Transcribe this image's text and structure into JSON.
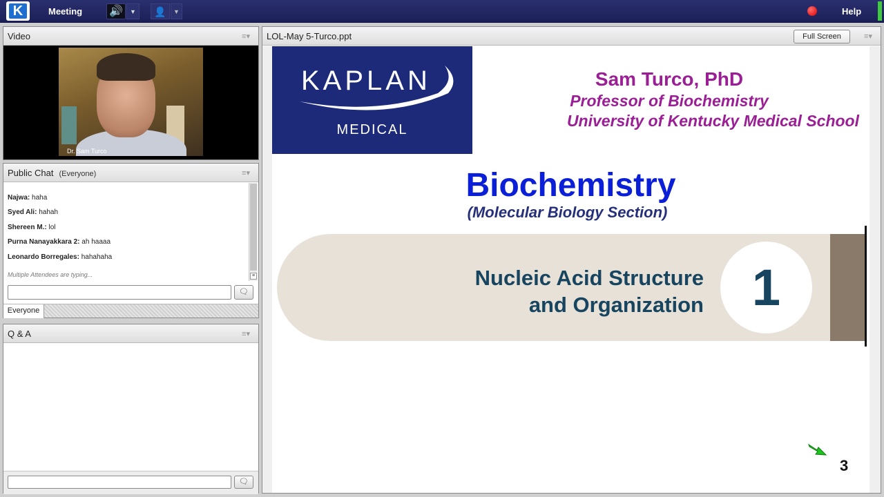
{
  "toolbar": {
    "logo_letter": "K",
    "meeting_label": "Meeting",
    "help_label": "Help",
    "speaker_icon": "speaker-icon",
    "user_icon": "user-voice-icon",
    "record_color": "#e00000"
  },
  "video_pod": {
    "title": "Video",
    "presenter_label": "Dr. Sam Turco"
  },
  "chat_pod": {
    "title": "Public Chat",
    "audience": "(Everyone)",
    "messages": [
      {
        "name": "Najwa",
        "text": "haha"
      },
      {
        "name": "Syed Ali",
        "text": "hahah"
      },
      {
        "name": "Shereen M.",
        "text": "lol"
      },
      {
        "name": "Purna Nanayakkara 2",
        "text": "ah haaaa"
      },
      {
        "name": "Leonardo Borregales",
        "text": "hahahaha"
      }
    ],
    "typing_status": "Multiple Attendees are typing...",
    "input_value": "",
    "tab_label": "Everyone"
  },
  "qa_pod": {
    "title": "Q & A",
    "input_value": ""
  },
  "share_pod": {
    "title": "LOL-May 5-Turco.ppt",
    "full_screen_label": "Full Screen"
  },
  "slide": {
    "brand_name": "KAPLAN",
    "brand_sub": "MEDICAL",
    "speaker_name": "Sam Turco, PhD",
    "speaker_role": "Professor of Biochemistry",
    "speaker_school": "University of Kentucky Medical School",
    "course_title": "Biochemistry",
    "course_subtitle": "(Molecular Biology Section)",
    "chapter_title_line1": "Nucleic Acid Structure",
    "chapter_title_line2": "and Organization",
    "chapter_number": "1",
    "page_number": "3",
    "colors": {
      "brand_blue": "#1d2a7a",
      "speaker_purple": "#9a1f94",
      "title_blue": "#0a1fd6",
      "chapter_teal": "#17445e"
    }
  }
}
